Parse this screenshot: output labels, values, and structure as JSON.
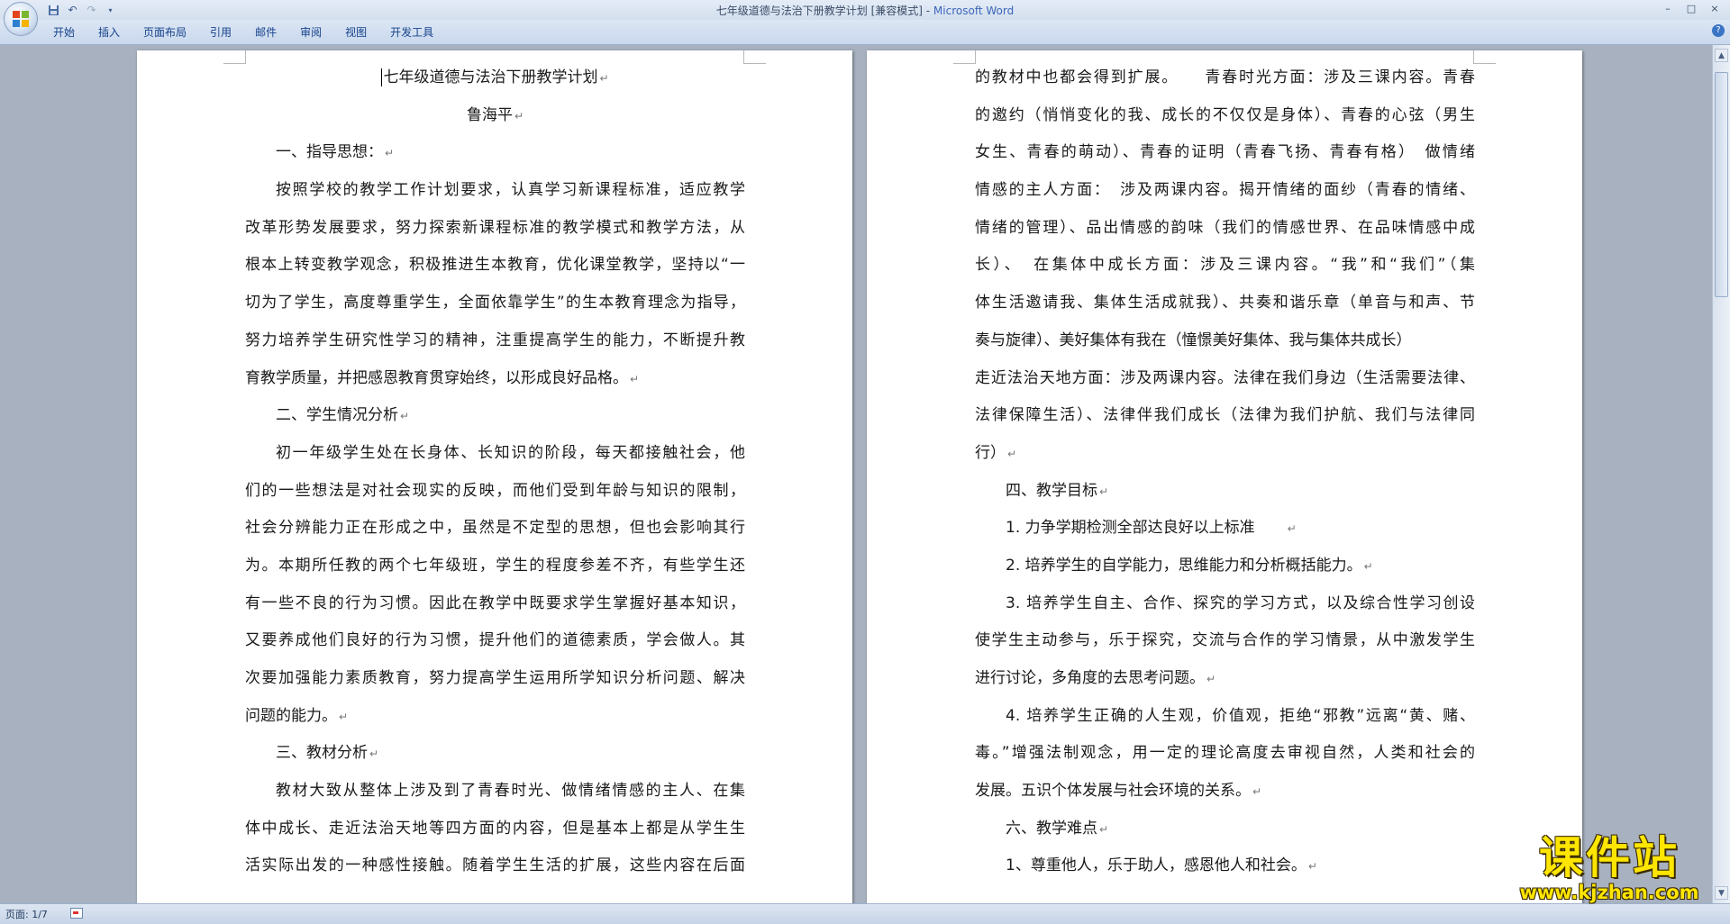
{
  "window": {
    "title": "七年级道德与法治下册教学计划 [兼容模式] - ",
    "app_name": "Microsoft Word",
    "controls": [
      "–",
      "□",
      "×"
    ]
  },
  "quick_access": [
    "save-icon",
    "undo-icon",
    "redo-icon",
    "customize-icon"
  ],
  "ribbon": {
    "tabs": [
      "开始",
      "插入",
      "页面布局",
      "引用",
      "邮件",
      "审阅",
      "视图",
      "开发工具"
    ],
    "help_label": "?"
  },
  "document": {
    "left_page": [
      {
        "text": "七年级道德与法治下册教学计划",
        "align": "center",
        "indent": 0,
        "mark": true,
        "caret": true
      },
      {
        "text": "鲁海平",
        "align": "center",
        "indent": 0,
        "mark": true
      },
      {
        "text": "一、指导思想：",
        "align": "left",
        "indent": 2,
        "mark": true
      },
      {
        "text": "按照学校的教学工作计划要求，认真学习新课程标准，适应教学",
        "align": "justify",
        "indent": 2
      },
      {
        "text": "改革形势发展要求，努力探索新课程标准的教学模式和教学方法，从",
        "align": "justify",
        "indent": 0
      },
      {
        "text": "根本上转变教学观念，积极推进生本教育，优化课堂教学，坚持以“一",
        "align": "justify",
        "indent": 0
      },
      {
        "text": "切为了学生，高度尊重学生，全面依靠学生”的生本教育理念为指导，",
        "align": "justify",
        "indent": 0
      },
      {
        "text": "努力培养学生研究性学习的精神，注重提高学生的能力，不断提升教",
        "align": "justify",
        "indent": 0
      },
      {
        "text": "育教学质量，并把感恩教育贯穿始终，以形成良好品格。",
        "align": "left",
        "indent": 0,
        "mark": true
      },
      {
        "text": "二、学生情况分析",
        "align": "left",
        "indent": 2,
        "mark": true
      },
      {
        "text": "初一年级学生处在长身体、长知识的阶段，每天都接触社会，他",
        "align": "justify",
        "indent": 2
      },
      {
        "text": "们的一些想法是对社会现实的反映，而他们受到年龄与知识的限制，",
        "align": "justify",
        "indent": 0
      },
      {
        "text": "社会分辨能力正在形成之中，虽然是不定型的思想，但也会影响其行",
        "align": "justify",
        "indent": 0
      },
      {
        "text": "为。本期所任教的两个七年级班，学生的程度参差不齐，有些学生还",
        "align": "justify",
        "indent": 0
      },
      {
        "text": "有一些不良的行为习惯。因此在教学中既要求学生掌握好基本知识，",
        "align": "justify",
        "indent": 0
      },
      {
        "text": "又要养成他们良好的行为习惯，提升他们的道德素质，学会做人。其",
        "align": "justify",
        "indent": 0
      },
      {
        "text": "次要加强能力素质教育，努力提高学生运用所学知识分析问题、解决",
        "align": "justify",
        "indent": 0
      },
      {
        "text": "问题的能力。",
        "align": "left",
        "indent": 0,
        "mark": true
      },
      {
        "text": "三、教材分析",
        "align": "left",
        "indent": 2,
        "mark": true
      },
      {
        "text": "教材大致从整体上涉及到了青春时光、做情绪情感的主人、在集",
        "align": "justify",
        "indent": 2
      },
      {
        "text": "体中成长、走近法治天地等四方面的内容，但是基本上都是从学生生",
        "align": "justify",
        "indent": 0
      },
      {
        "text": "活实际出发的一种感性接触。随着学生生活的扩展，这些内容在后面",
        "align": "justify",
        "indent": 0
      }
    ],
    "right_page": [
      {
        "text": "的教材中也都会得到扩展。　　青春时光方面：涉及三课内容。青春",
        "align": "justify",
        "indent": 0
      },
      {
        "text": "的邀约（悄悄变化的我、成长的不仅仅是身体）、青春的心弦（男生",
        "align": "justify",
        "indent": 0
      },
      {
        "text": "女生、青春的萌动）、青春的证明（青春飞扬、青春有格）　做情绪",
        "align": "justify",
        "indent": 0
      },
      {
        "text": "情感的主人方面：　涉及两课内容。揭开情绪的面纱（青春的情绪、",
        "align": "justify",
        "indent": 0
      },
      {
        "text": "情绪的管理）、品出情感的韵味（我们的情感世界、在品味情感中成",
        "align": "justify",
        "indent": 0
      },
      {
        "text": "长）、　在集体中成长方面：涉及三课内容。“我”和“我们”（集",
        "align": "justify",
        "indent": 0
      },
      {
        "text": "体生活邀请我、集体生活成就我）、共奏和谐乐章（单音与和声、节",
        "align": "justify",
        "indent": 0
      },
      {
        "text": "奏与旋律）、美好集体有我在（憧憬美好集体、我与集体共成长）",
        "align": "left",
        "indent": 0
      },
      {
        "text": "走近法治天地方面：涉及两课内容。法律在我们身边（生活需要法律、",
        "align": "justify",
        "indent": 0
      },
      {
        "text": "法律保障生活）、法律伴我们成长（法律为我们护航、我们与法律同",
        "align": "justify",
        "indent": 0
      },
      {
        "text": "行）",
        "align": "left",
        "indent": 0,
        "mark": true
      },
      {
        "text": "四、教学目标",
        "align": "left",
        "indent": 2,
        "mark": true
      },
      {
        "text": "1. 力争学期检测全部达良好以上标准　　",
        "align": "left",
        "indent": 2,
        "mark": true
      },
      {
        "text": "2. 培养学生的自学能力，思维能力和分析概括能力。",
        "align": "left",
        "indent": 2,
        "mark": true
      },
      {
        "text": "3. 培养学生自主、合作、探究的学习方式，以及综合性学习创设",
        "align": "justify",
        "indent": 2
      },
      {
        "text": "使学生主动参与，乐于探究，交流与合作的学习情景，从中激发学生",
        "align": "justify",
        "indent": 0
      },
      {
        "text": "进行讨论，多角度的去思考问题。",
        "align": "left",
        "indent": 0,
        "mark": true
      },
      {
        "text": "4. 培养学生正确的人生观，价值观，拒绝“邪教”远离“黄、赌、",
        "align": "justify",
        "indent": 2
      },
      {
        "text": "毒。”增强法制观念，用一定的理论高度去审视自然，人类和社会的",
        "align": "justify",
        "indent": 0
      },
      {
        "text": "发展。五识个体发展与社会环境的关系。",
        "align": "left",
        "indent": 0,
        "mark": true
      },
      {
        "text": "六、教学难点",
        "align": "left",
        "indent": 2,
        "mark": true
      },
      {
        "text": "1、尊重他人，乐于助人，感恩他人和社会。",
        "align": "left",
        "indent": 2,
        "mark": true
      }
    ],
    "paragraph_mark": "↵"
  },
  "scrollbar": {
    "up": "▲",
    "down": "▼"
  },
  "statusbar": {
    "page_info": "页面: 1/7"
  },
  "watermark": {
    "name": "课件站",
    "url": "www.kjzhan.com"
  }
}
